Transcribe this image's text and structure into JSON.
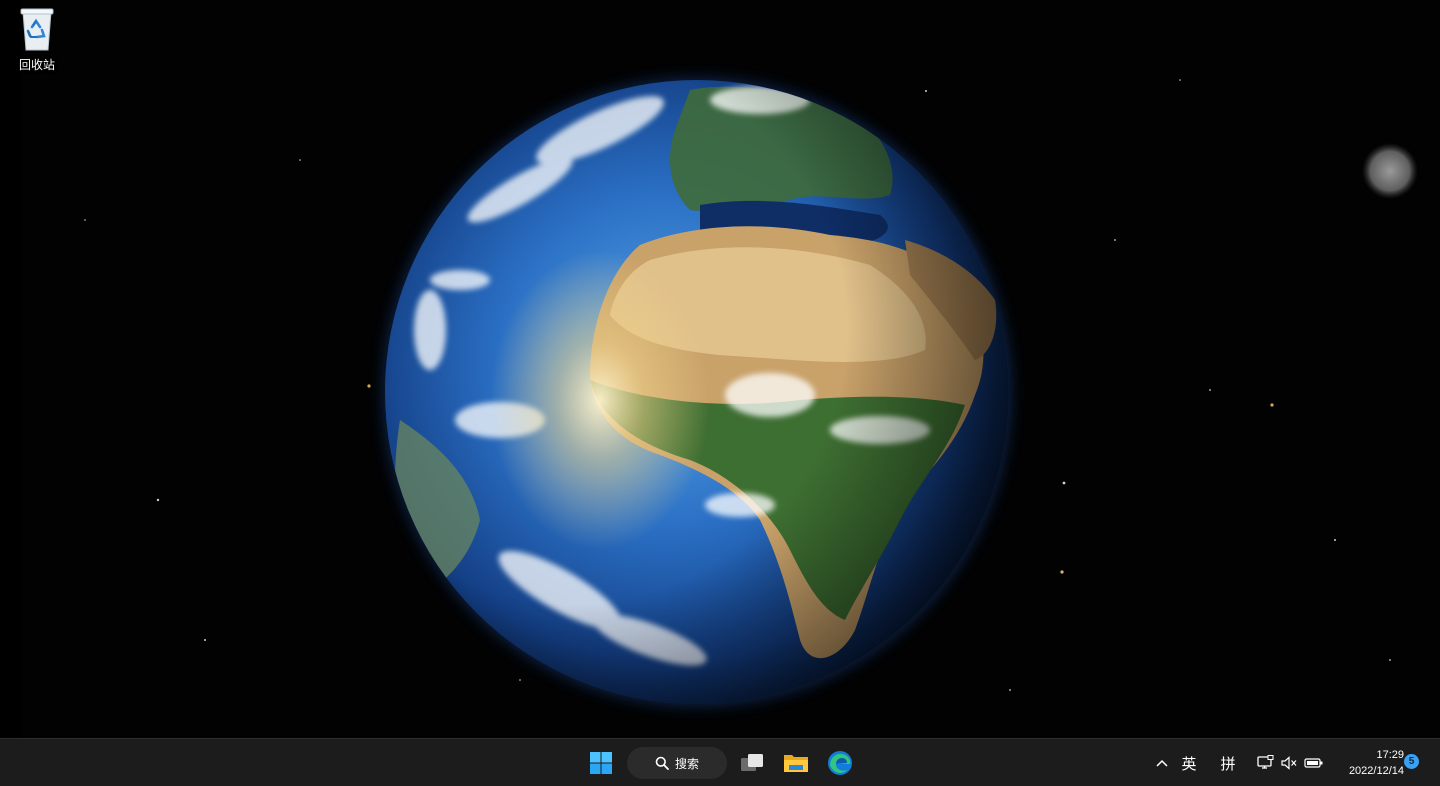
{
  "desktop": {
    "icons": [
      {
        "label": "回收站",
        "icon": "recycle-bin-icon"
      }
    ],
    "wallpaper": "earth-from-space"
  },
  "taskbar": {
    "start_icon": "windows-logo-icon",
    "search_label": "搜索",
    "search_icon": "search-icon",
    "pinned": [
      {
        "icon": "task-view-icon"
      },
      {
        "icon": "file-explorer-icon"
      },
      {
        "icon": "edge-browser-icon"
      }
    ],
    "tray": {
      "overflow_icon": "chevron-up-icon",
      "ime_language": "英",
      "ime_mode": "拼",
      "network_icon": "network-icon",
      "volume_icon": "volume-muted-icon",
      "battery_icon": "battery-icon"
    },
    "clock": {
      "time": "17:29",
      "date": "2022/12/14"
    },
    "notification_badge": "5"
  },
  "colors": {
    "taskbar_bg": "#1c1c1c",
    "accent": "#3aa0f2"
  }
}
